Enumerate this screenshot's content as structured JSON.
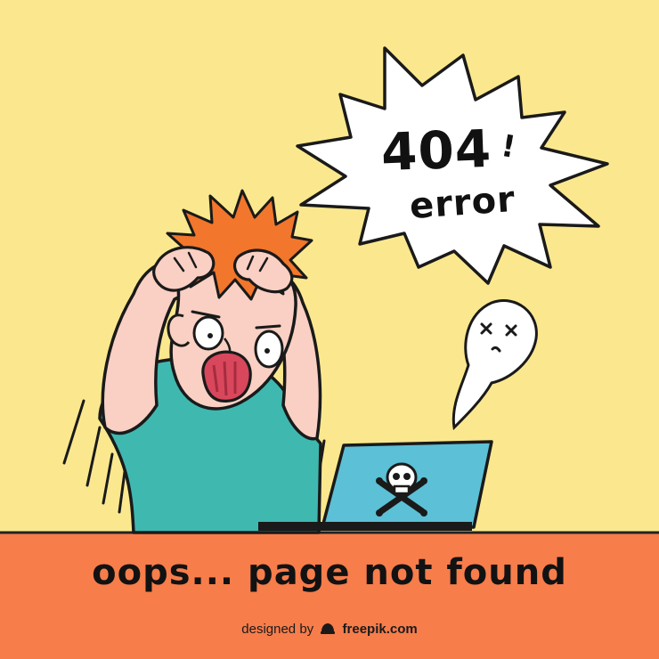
{
  "speech_bubble": {
    "code": "404",
    "exclamation": "!",
    "word": "error"
  },
  "footer": {
    "message": "oops... page not found"
  },
  "credit": {
    "prefix": "designed by",
    "brand": "freepik.com"
  },
  "icons": [
    "dead-face-icon",
    "skull-crossbones-icon",
    "freepik-logo-icon"
  ],
  "colors": {
    "background": "#fbe88e",
    "desk": "#f77d4b",
    "shirt": "#3fb8b0",
    "hair": "#f2762b",
    "skin": "#f9d0c3",
    "laptop": "#5cc0d6",
    "mouth": "#d9475c"
  }
}
